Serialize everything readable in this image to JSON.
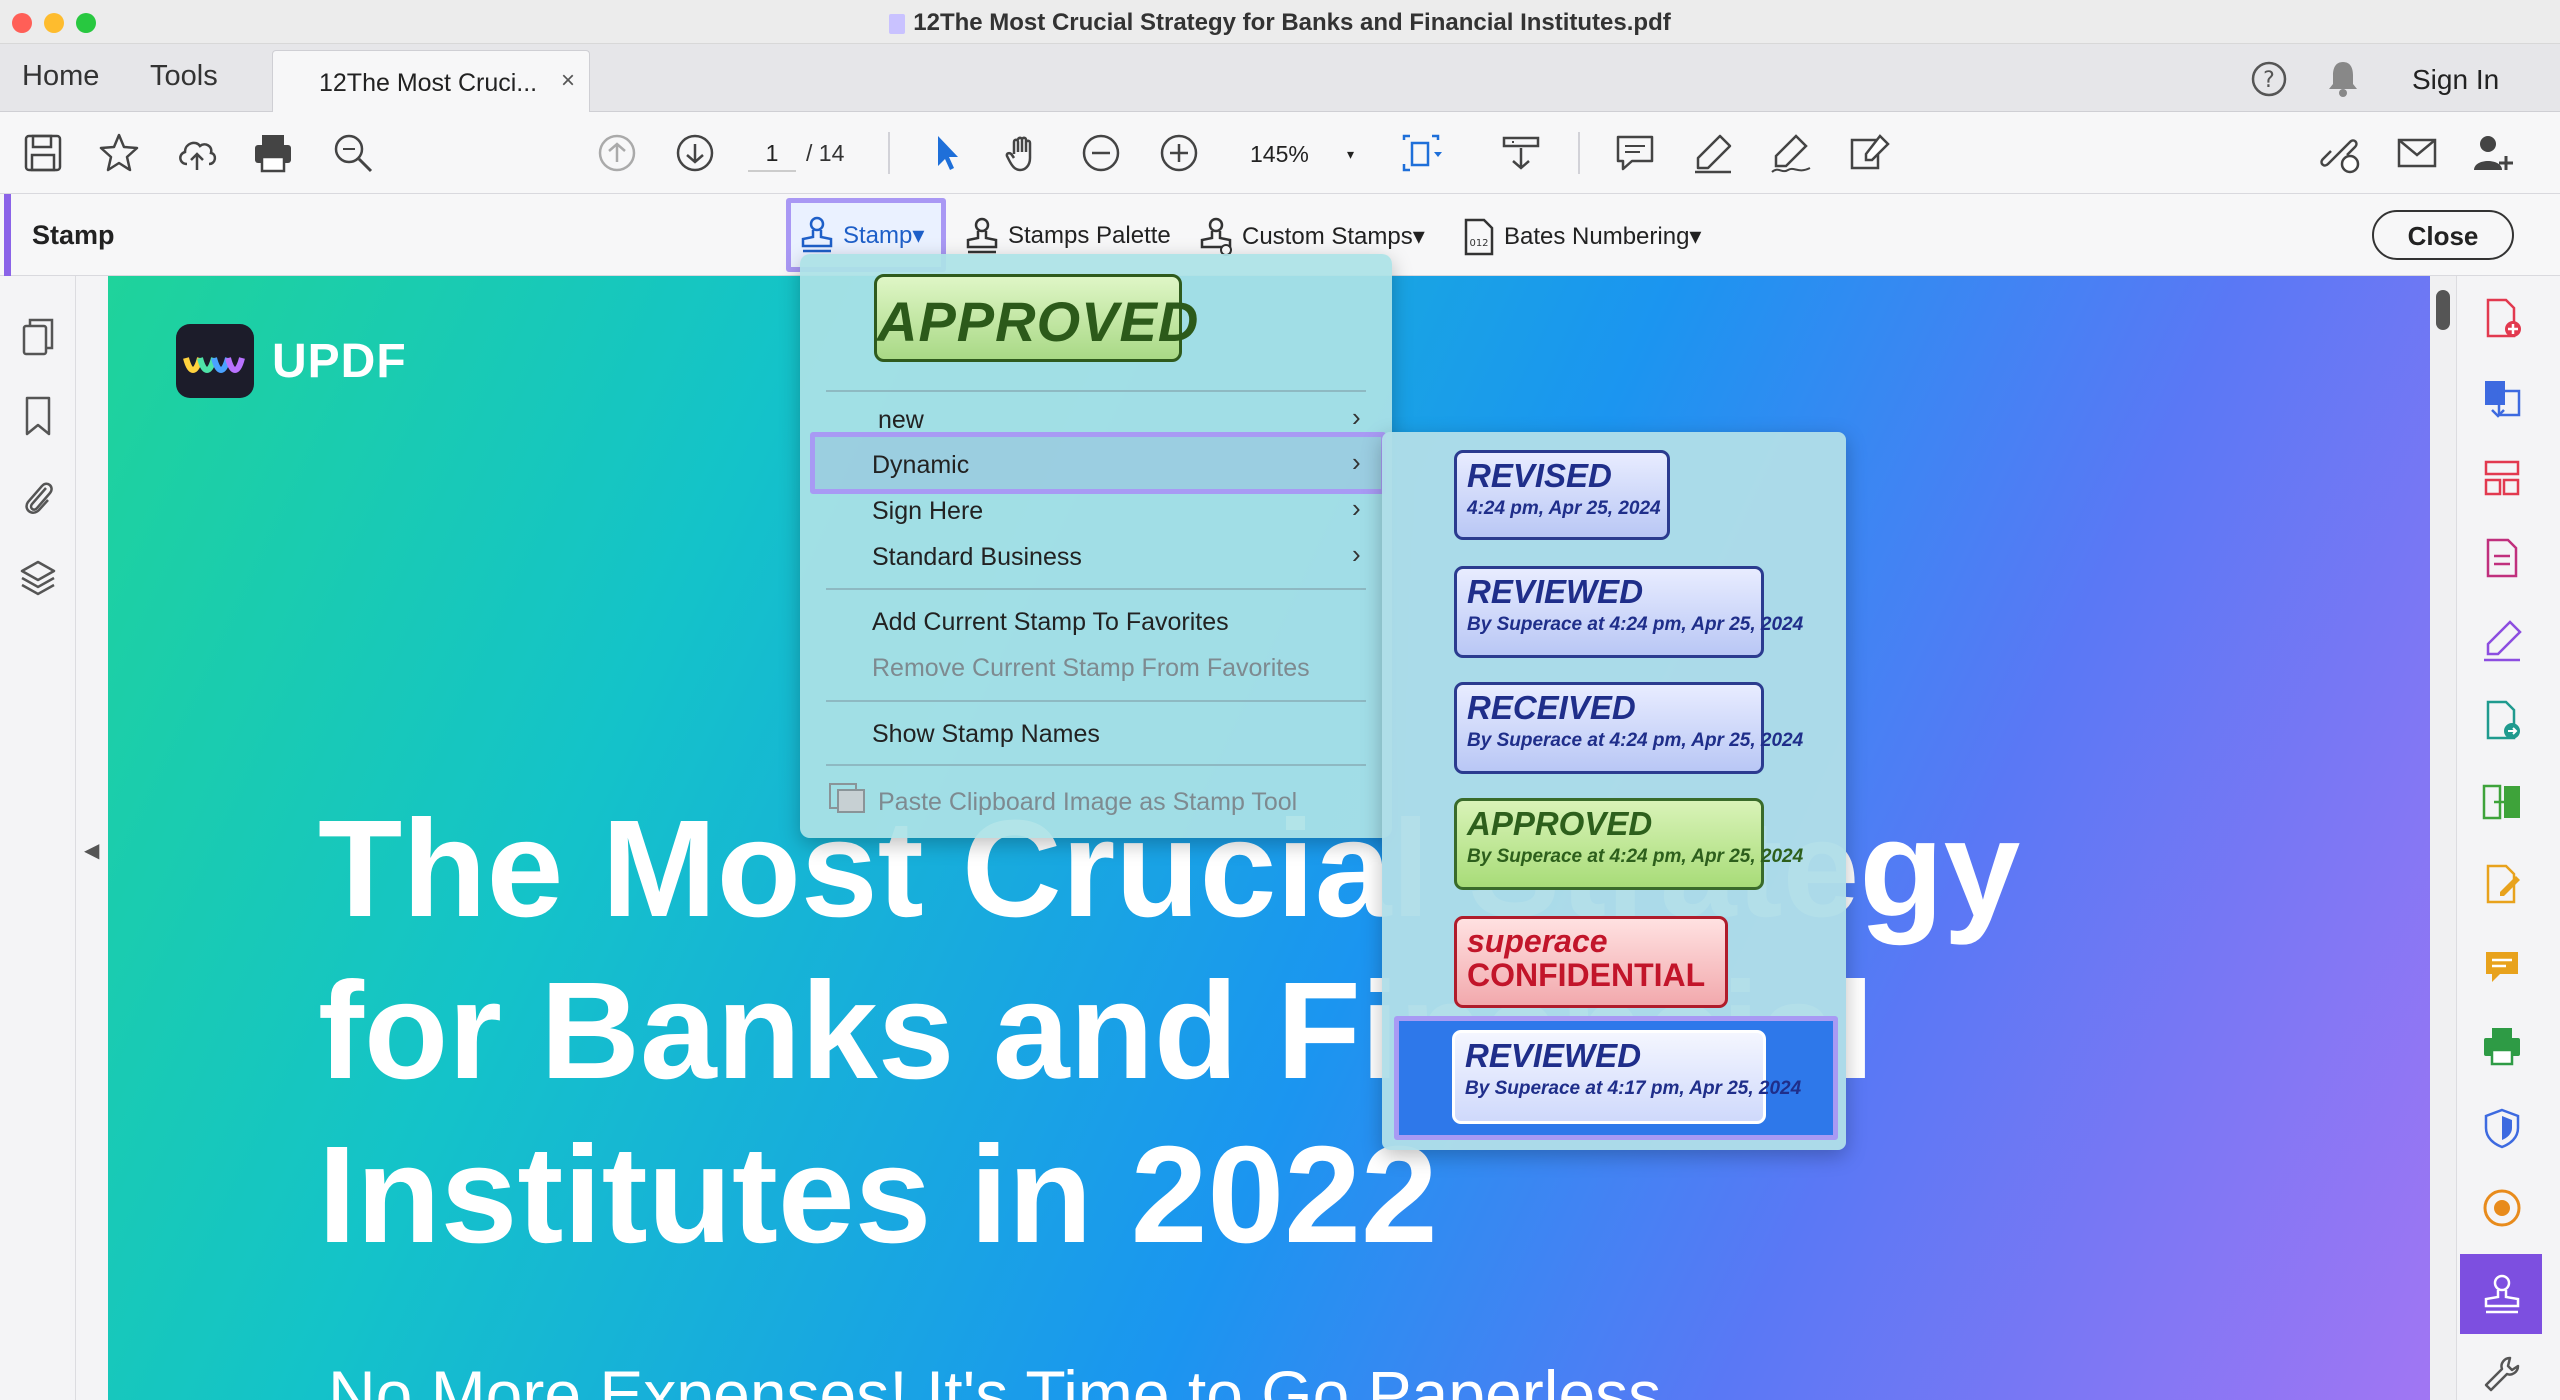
{
  "window": {
    "title": "12The Most Crucial Strategy for Banks and Financial Institutes.pdf"
  },
  "tabs": {
    "home": "Home",
    "tools": "Tools",
    "document_tab": "12The Most Cruci...",
    "close_glyph": "×",
    "sign_in": "Sign In"
  },
  "toolbar": {
    "page_current": "1",
    "page_total": "/ 14",
    "zoom": "145%",
    "zoom_caret": "▾"
  },
  "stampbar": {
    "title": "Stamp",
    "stamp": "Stamp▾",
    "stamps_palette": "Stamps Palette",
    "custom_stamps": "Custom Stamps▾",
    "bates_numbering": "Bates Numbering▾",
    "close": "Close"
  },
  "stamp_menu": {
    "preview": "APPROVED",
    "items": [
      {
        "label": "new",
        "submenu": true
      },
      {
        "label": "Dynamic",
        "submenu": true,
        "highlighted": true
      },
      {
        "label": "Sign Here",
        "submenu": true
      },
      {
        "label": "Standard Business",
        "submenu": true
      }
    ],
    "add_favorite": "Add Current Stamp To Favorites",
    "remove_favorite": "Remove Current Stamp From Favorites",
    "show_names": "Show Stamp Names",
    "paste_clipboard": "Paste Clipboard Image as Stamp Tool",
    "chevron": "›"
  },
  "dynamic_submenu": {
    "stamps": [
      {
        "title": "REVISED",
        "detail": "4:24 pm, Apr 25, 2024"
      },
      {
        "title": "REVIEWED",
        "detail": "By Superace at 4:24 pm, Apr 25, 2024"
      },
      {
        "title": "RECEIVED",
        "detail": "By Superace at 4:24 pm, Apr 25, 2024"
      },
      {
        "title": "APPROVED",
        "detail": "By Superace at 4:24 pm, Apr 25, 2024"
      },
      {
        "title": "superace",
        "detail": "CONFIDENTIAL"
      },
      {
        "title": "REVIEWED",
        "detail": "By Superace at 4:17 pm, Apr 25, 2024",
        "selected": true
      }
    ]
  },
  "document": {
    "brand": "UPDF",
    "heading_lines": [
      "The Most Crucial Strategy",
      "for Banks and Financial",
      "Institutes in 2022"
    ],
    "subheading": "No More Expenses! It's Time to Go Paperless"
  },
  "colors": {
    "accent": "#7d4fe0",
    "highlight_border": "#a89af4",
    "selection": "#2e78ea"
  },
  "icons": {
    "left_sidebar": [
      "pages-icon",
      "bookmark-icon",
      "attachment-icon",
      "layers-icon"
    ],
    "right_sidebar": [
      "add-pdf-icon",
      "convert-icon",
      "organize-icon",
      "compress-icon",
      "sign-icon",
      "export-icon",
      "compare-icon",
      "edit-icon",
      "comment-icon",
      "print-production-icon",
      "protect-icon",
      "accessibility-icon",
      "stamp-icon",
      "tools-icon"
    ]
  }
}
